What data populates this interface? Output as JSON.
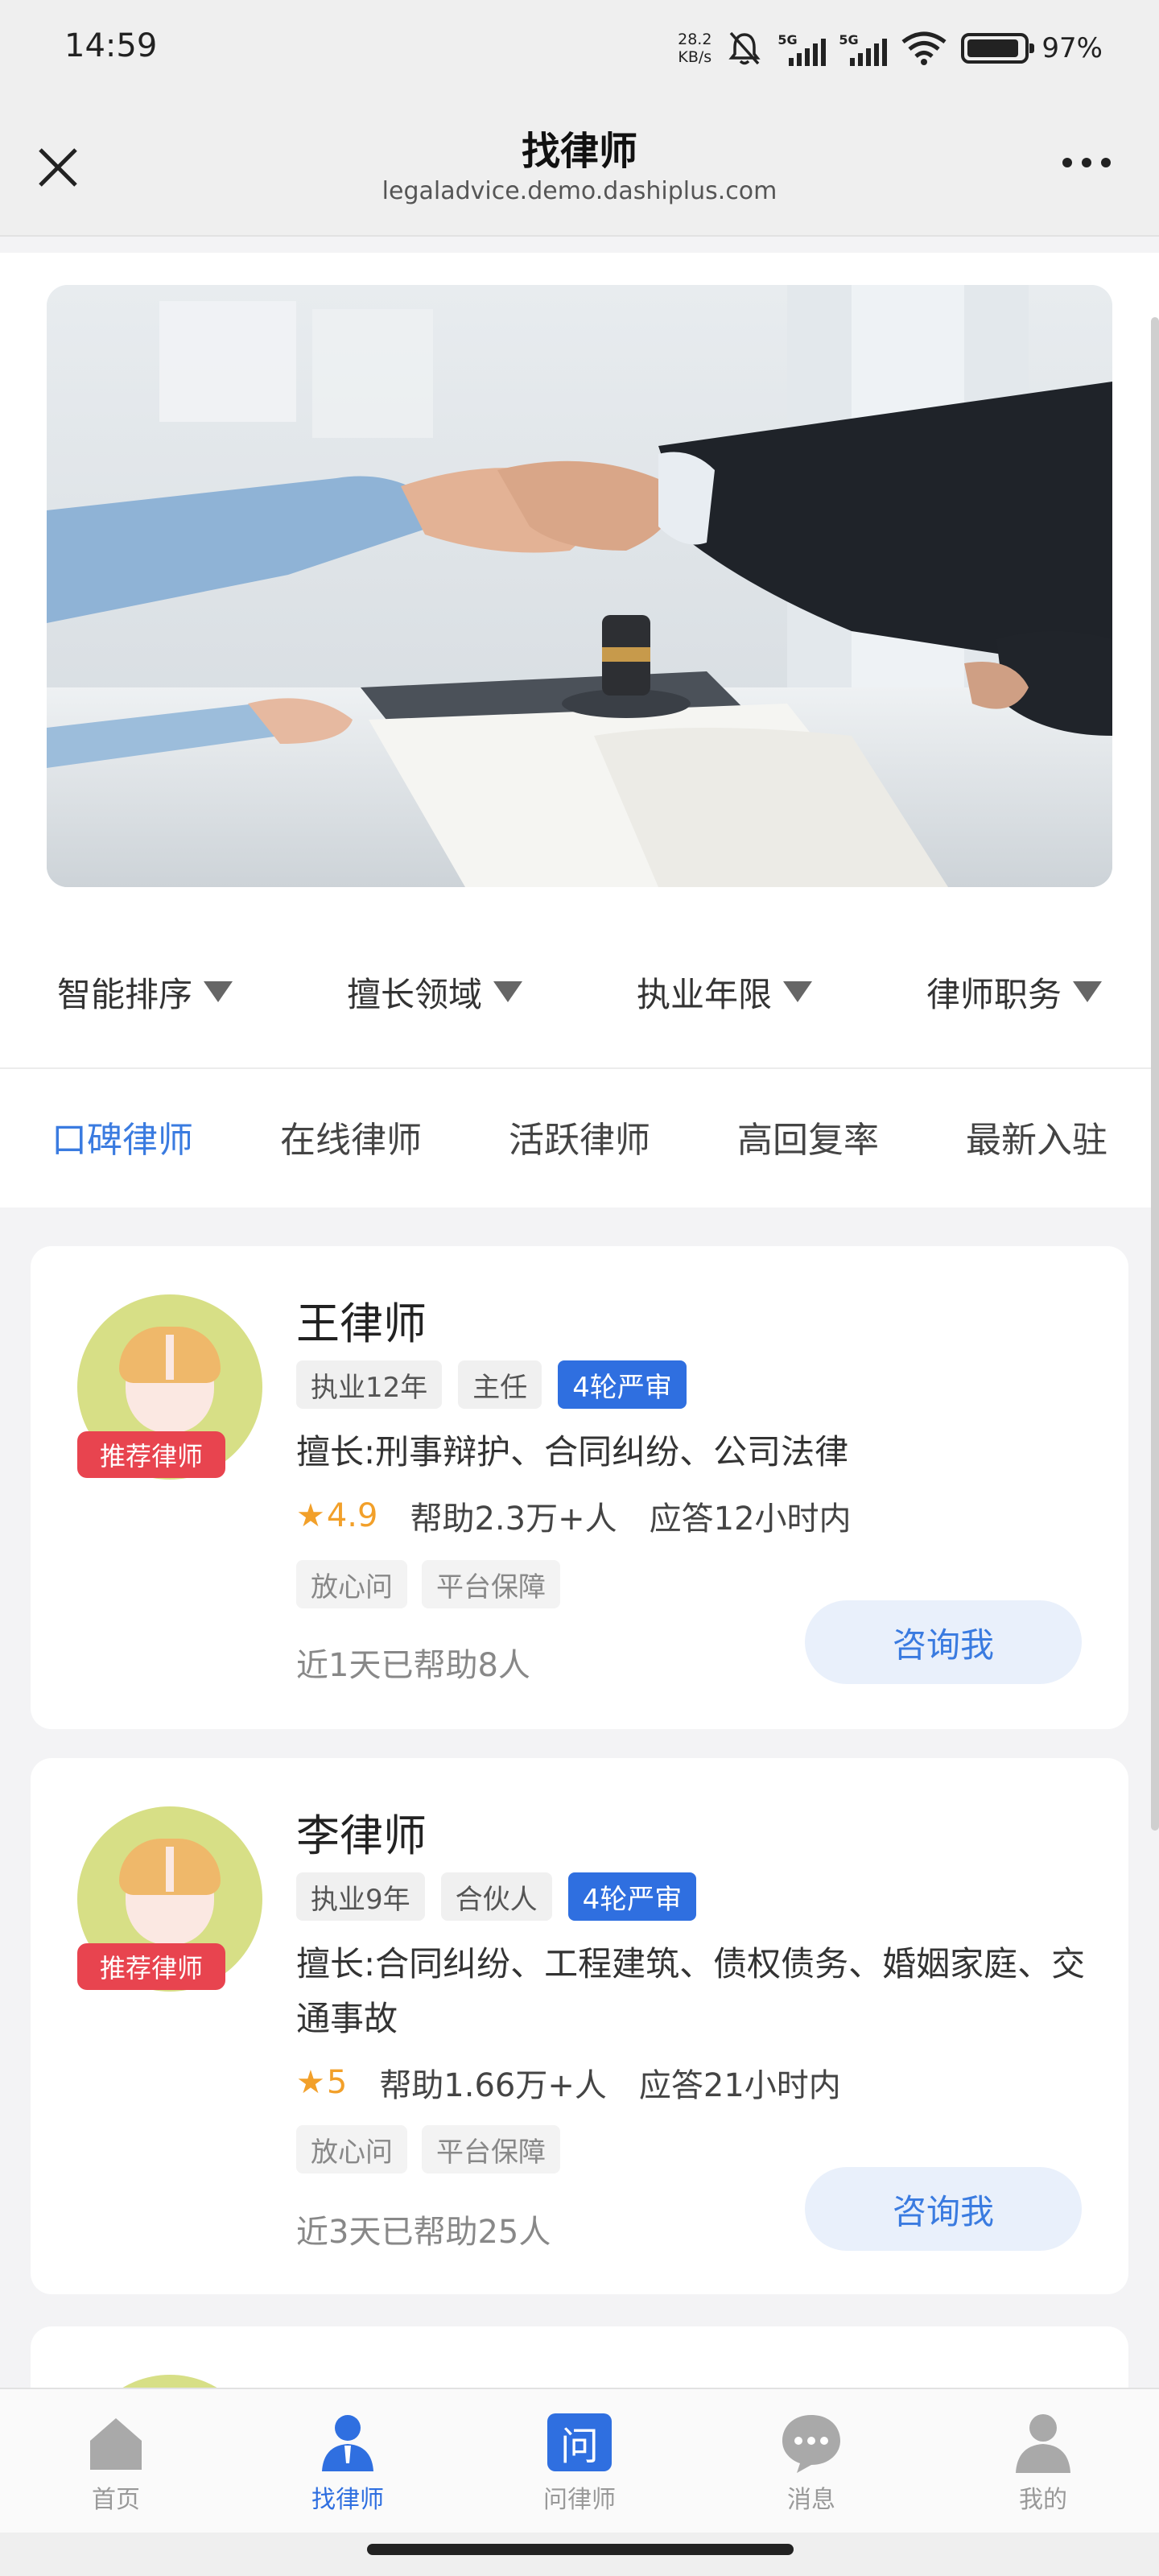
{
  "status_bar": {
    "time": "14:59",
    "net_speed_value": "28.2",
    "net_speed_unit": "KB/s",
    "signal_1_label": "5G",
    "signal_2_label": "5G",
    "battery_percent": "97%"
  },
  "nav": {
    "title": "找律师",
    "url": "legaladvice.demo.dashiplus.com"
  },
  "filters": [
    {
      "label": "智能排序"
    },
    {
      "label": "擅长领域"
    },
    {
      "label": "执业年限"
    },
    {
      "label": "律师职务"
    }
  ],
  "tabs": [
    {
      "label": "口碑律师",
      "active": true
    },
    {
      "label": "在线律师",
      "active": false
    },
    {
      "label": "活跃律师",
      "active": false
    },
    {
      "label": "高回复率",
      "active": false
    },
    {
      "label": "最新入驻",
      "active": false
    }
  ],
  "lawyers": [
    {
      "name": "王律师",
      "badge": "推荐律师",
      "years": "执业12年",
      "position": "主任",
      "review": "4轮严审",
      "speciality": "擅长:刑事辩护、合同纠纷、公司法律",
      "rating": "4.9",
      "helped": "帮助2.3万+人",
      "response": "应答12小时内",
      "guarantee_1": "放心问",
      "guarantee_2": "平台保障",
      "recent": "近1天已帮助8人",
      "consult_label": "咨询我"
    },
    {
      "name": "李律师",
      "badge": "推荐律师",
      "years": "执业9年",
      "position": "合伙人",
      "review": "4轮严审",
      "speciality": "擅长:合同纠纷、工程建筑、债权债务、婚姻家庭、交通事故",
      "rating": "5",
      "helped": "帮助1.66万+人",
      "response": "应答21小时内",
      "guarantee_1": "放心问",
      "guarantee_2": "平台保障",
      "recent": "近3天已帮助25人",
      "consult_label": "咨询我"
    }
  ],
  "tabbar": [
    {
      "label": "首页",
      "icon": "home-icon"
    },
    {
      "label": "找律师",
      "icon": "lawyer-icon",
      "active": true
    },
    {
      "label": "问律师",
      "icon": "ask-icon",
      "glyph": "问"
    },
    {
      "label": "消息",
      "icon": "message-icon"
    },
    {
      "label": "我的",
      "icon": "profile-icon"
    }
  ],
  "colors": {
    "accent": "#3a7be0",
    "recommend_badge": "#e8444f",
    "rating_star": "#f2a02a"
  }
}
